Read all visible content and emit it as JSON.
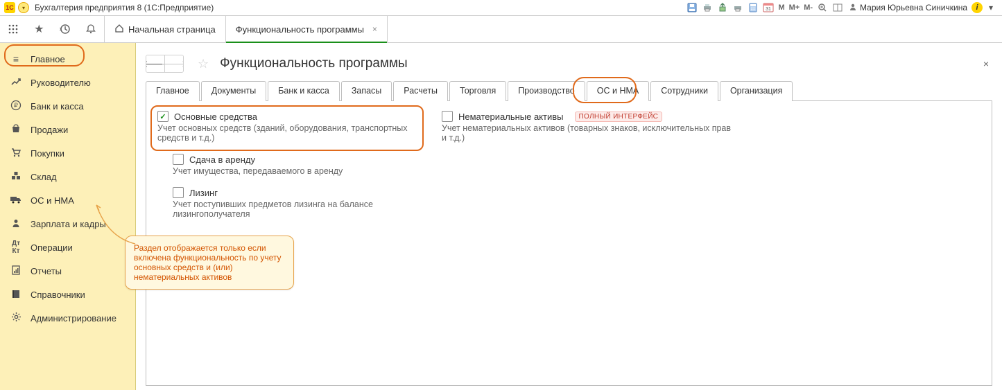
{
  "titlebar": {
    "app_title": "Бухгалтерия предприятия 8  (1С:Предприятие)",
    "user_name": "Мария Юрьевна Синичкина",
    "m_btn": "M",
    "mplus_btn": "M+",
    "mminus_btn": "M-",
    "cal_day": "31"
  },
  "apptabs": {
    "home": "Начальная страница",
    "current": "Функциональность программы"
  },
  "sidebar": {
    "items": [
      {
        "label": "Главное"
      },
      {
        "label": "Руководителю"
      },
      {
        "label": "Банк и касса"
      },
      {
        "label": "Продажи"
      },
      {
        "label": "Покупки"
      },
      {
        "label": "Склад"
      },
      {
        "label": "ОС и НМА"
      },
      {
        "label": "Зарплата и кадры"
      },
      {
        "label": "Операции"
      },
      {
        "label": "Отчеты"
      },
      {
        "label": "Справочники"
      },
      {
        "label": "Администрирование"
      }
    ]
  },
  "page": {
    "title": "Функциональность программы",
    "tabs": [
      "Главное",
      "Документы",
      "Банк и касса",
      "Запасы",
      "Расчеты",
      "Торговля",
      "Производство",
      "ОС и НМА",
      "Сотрудники",
      "Организация"
    ],
    "active_tab_index": 7
  },
  "options": {
    "fixed_assets": {
      "label": "Основные средства",
      "checked": true,
      "desc": "Учет основных средств (зданий, оборудования, транспортных средств и т.д.)"
    },
    "rent": {
      "label": "Сдача в аренду",
      "checked": false,
      "desc": "Учет имущества, передаваемого в аренду"
    },
    "leasing": {
      "label": "Лизинг",
      "checked": false,
      "desc": "Учет поступивших предметов лизинга на балансе лизингополучателя"
    },
    "intangible": {
      "label": "Нематериальные активы",
      "checked": false,
      "desc": "Учет нематериальных активов (товарных знаков, исключительных прав и т.д.)",
      "badge": "ПОЛНЫЙ ИНТЕРФЕЙС"
    }
  },
  "callout": {
    "text": "Раздел отображается только если включена функциональность по учету основных средств и (или) нематериальных активов"
  }
}
